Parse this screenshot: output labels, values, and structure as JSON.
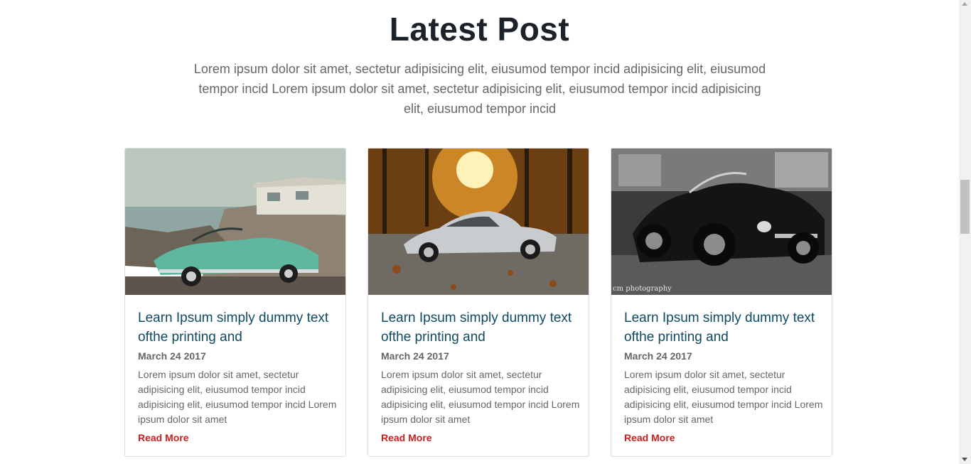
{
  "section": {
    "title": "Latest Post",
    "intro": "Lorem ipsum dolor sit amet, sectetur adipisicing elit, eiusumod tempor incid adipisicing elit, eiusumod tempor incid Lorem ipsum dolor sit amet, sectetur adipisicing elit, eiusumod tempor incid adipisicing elit, eiusumod tempor incid"
  },
  "posts": [
    {
      "title": "Learn Ipsum simply dummy text ofthe printing and",
      "date": "March 24 2017",
      "excerpt": "Lorem ipsum dolor sit amet, sectetur adipisicing elit, eiusumod tempor incid adipisicing elit, eiusumod tempor incid Lorem ipsum dolor sit amet",
      "read_more": "Read More"
    },
    {
      "title": "Learn Ipsum simply dummy text ofthe printing and",
      "date": "March 24 2017",
      "excerpt": "Lorem ipsum dolor sit amet, sectetur adipisicing elit, eiusumod tempor incid adipisicing elit, eiusumod tempor incid Lorem ipsum dolor sit amet",
      "read_more": "Read More"
    },
    {
      "title": "Learn Ipsum simply dummy text ofthe printing and",
      "date": "March 24 2017",
      "excerpt": "Lorem ipsum dolor sit amet, sectetur adipisicing elit, eiusumod tempor incid adipisicing elit, eiusumod tempor incid Lorem ipsum dolor sit amet",
      "read_more": "Read More"
    }
  ],
  "images": {
    "photo_credit": "cm photography"
  },
  "colors": {
    "heading": "#1c2229",
    "card_title": "#0f4a63",
    "read_more": "#cc1e1e",
    "body_text": "#666666"
  }
}
